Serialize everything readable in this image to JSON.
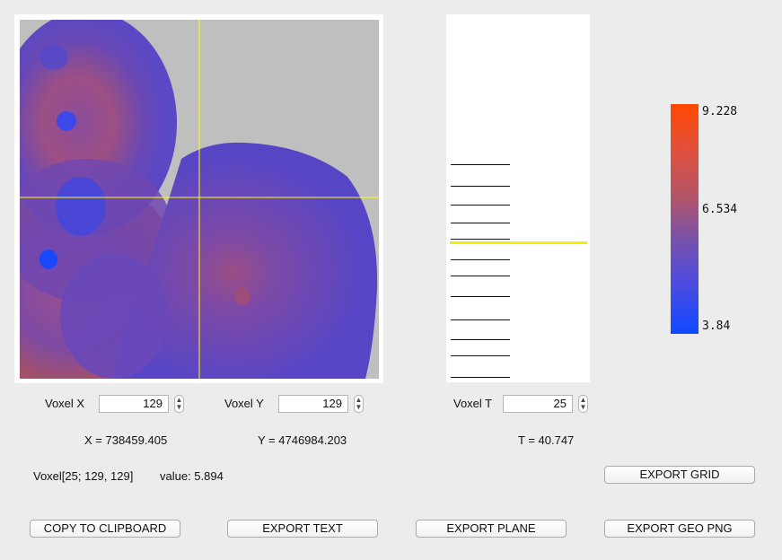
{
  "map": {
    "crosshair_color": "#ffff00",
    "background_color": "#bfbfbf"
  },
  "time_axis": {
    "cursor_color": "#f0f000"
  },
  "colorbar": {
    "max_label": "9.228",
    "mid_label": "6.534",
    "min_label": "3.84",
    "max_color": "#ff4700",
    "min_color": "#0f49ff"
  },
  "voxel_x": {
    "label": "Voxel X",
    "value": "129"
  },
  "voxel_y": {
    "label": "Voxel Y",
    "value": "129"
  },
  "voxel_t": {
    "label": "Voxel T",
    "value": "25"
  },
  "coords": {
    "x": "X = 738459.405",
    "y": "Y = 4746984.203",
    "t": "T = 40.747"
  },
  "info": {
    "voxel": "Voxel[25; 129, 129]",
    "value": "value: 5.894"
  },
  "buttons": {
    "export_grid": "EXPORT GRID",
    "copy": "COPY TO CLIPBOARD",
    "export_text": "EXPORT TEXT",
    "export_plane": "EXPORT PLANE",
    "export_geo_png": "EXPORT GEO PNG"
  }
}
